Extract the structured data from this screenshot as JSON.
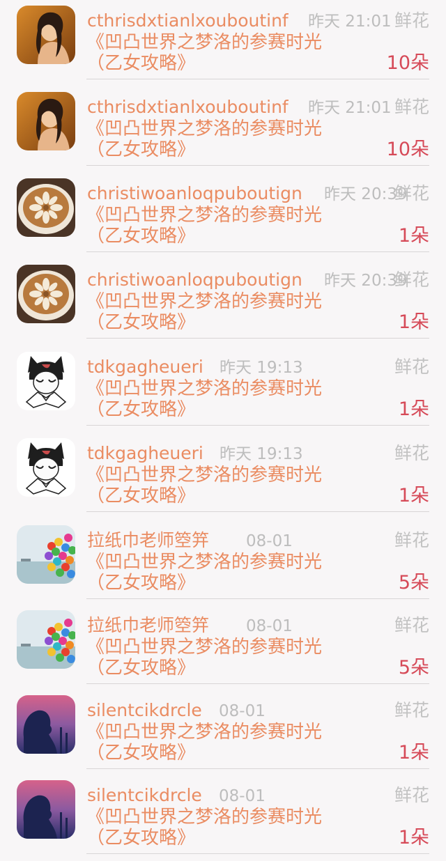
{
  "colors": {
    "name": "#ea8c62",
    "time": "#bdbdbd",
    "label": "#c2c2c2",
    "count": "#d64a58",
    "background": "#f8f6f7"
  },
  "gifts": [
    {
      "user": "cthrisdxtianlxouboutinf",
      "time": "昨天 21:01",
      "label": "鲜花",
      "title_line1": "《凹凸世界之梦洛的参赛时光",
      "title_line2": "（乙女攻略》",
      "count": "10朵",
      "avatar": "portrait-woman"
    },
    {
      "user": "cthrisdxtianlxouboutinf",
      "time": "昨天 21:01",
      "label": "鲜花",
      "title_line1": "《凹凸世界之梦洛的参赛时光",
      "title_line2": "（乙女攻略》",
      "count": "10朵",
      "avatar": "portrait-woman"
    },
    {
      "user": "christiwoanloqpuboutign",
      "time": "昨天 20:39",
      "label": "鲜花",
      "title_line1": "《凹凸世界之梦洛的参赛时光",
      "title_line2": "（乙女攻略》",
      "count": "1朵",
      "avatar": "latte-art"
    },
    {
      "user": "christiwoanloqpuboutign",
      "time": "昨天 20:39",
      "label": "鲜花",
      "title_line1": "《凹凸世界之梦洛的参赛时光",
      "title_line2": "（乙女攻略》",
      "count": "1朵",
      "avatar": "latte-art"
    },
    {
      "user": "tdkgagheueri",
      "time": "昨天 19:13",
      "label": "鲜花",
      "title_line1": "《凹凸世界之梦洛的参赛时光",
      "title_line2": "（乙女攻略》",
      "count": "1朵",
      "avatar": "anime-cat-boy"
    },
    {
      "user": "tdkgagheueri",
      "time": "昨天 19:13",
      "label": "鲜花",
      "title_line1": "《凹凸世界之梦洛的参赛时光",
      "title_line2": "（乙女攻略》",
      "count": "1朵",
      "avatar": "anime-cat-boy"
    },
    {
      "user": "拉纸巾老师箜笄",
      "time": "08-01",
      "label": "鲜花",
      "title_line1": "《凹凸世界之梦洛的参赛时光",
      "title_line2": "（乙女攻略》",
      "count": "5朵",
      "avatar": "balloons"
    },
    {
      "user": "拉纸巾老师箜笄",
      "time": "08-01",
      "label": "鲜花",
      "title_line1": "《凹凸世界之梦洛的参赛时光",
      "title_line2": "（乙女攻略》",
      "count": "5朵",
      "avatar": "balloons"
    },
    {
      "user": "silentcikdrcle",
      "time": "08-01",
      "label": "鲜花",
      "title_line1": "《凹凸世界之梦洛的参赛时光",
      "title_line2": "（乙女攻略》",
      "count": "1朵",
      "avatar": "silhouette-sunset"
    },
    {
      "user": "silentcikdrcle",
      "time": "08-01",
      "label": "鲜花",
      "title_line1": "《凹凸世界之梦洛的参赛时光",
      "title_line2": "（乙女攻略》",
      "count": "1朵",
      "avatar": "silhouette-sunset"
    }
  ]
}
